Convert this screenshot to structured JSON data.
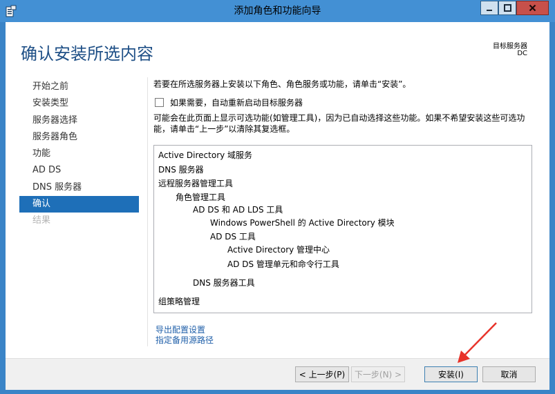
{
  "window": {
    "title": "添加角色和功能向导"
  },
  "header": {
    "page_title": "确认安装所选内容",
    "destination_label": "目标服务器",
    "destination_value": "DC"
  },
  "nav": {
    "items": [
      {
        "label": "开始之前",
        "state": "normal"
      },
      {
        "label": "安装类型",
        "state": "normal"
      },
      {
        "label": "服务器选择",
        "state": "normal"
      },
      {
        "label": "服务器角色",
        "state": "normal"
      },
      {
        "label": "功能",
        "state": "normal"
      },
      {
        "label": "AD DS",
        "state": "normal"
      },
      {
        "label": "DNS 服务器",
        "state": "normal"
      },
      {
        "label": "确认",
        "state": "active"
      },
      {
        "label": "结果",
        "state": "disabled"
      }
    ]
  },
  "main": {
    "intro": "若要在所选服务器上安装以下角色、角色服务或功能，请单击“安装”。",
    "restart_label": "如果需要，自动重新启动目标服务器",
    "restart_checked": false,
    "note": "可能会在此页面上显示可选功能(如管理工具)，因为已自动选择这些功能。如果不希望安装这些可选功能，请单击“上一步”以清除其复选框。",
    "selection_list": [
      "Active Directory 域服务",
      "DNS 服务器",
      "远程服务器管理工具",
      "角色管理工具",
      "AD DS 和 AD LDS 工具",
      "Windows PowerShell 的 Active Directory 模块",
      "AD DS 工具",
      "Active Directory 管理中心",
      "AD DS 管理单元和命令行工具",
      "DNS 服务器工具",
      "组策略管理"
    ],
    "export_link": "导出配置设置",
    "alt_source_link": "指定备用源路径"
  },
  "footer": {
    "previous": "< 上一步(P)",
    "next": "下一步(N) >",
    "install": "安装(I)",
    "cancel": "取消"
  },
  "colors": {
    "accent": "#1e6fb8",
    "title": "#1e4f86",
    "link": "#1f5fa9",
    "annotation_arrow": "#e8332a"
  }
}
